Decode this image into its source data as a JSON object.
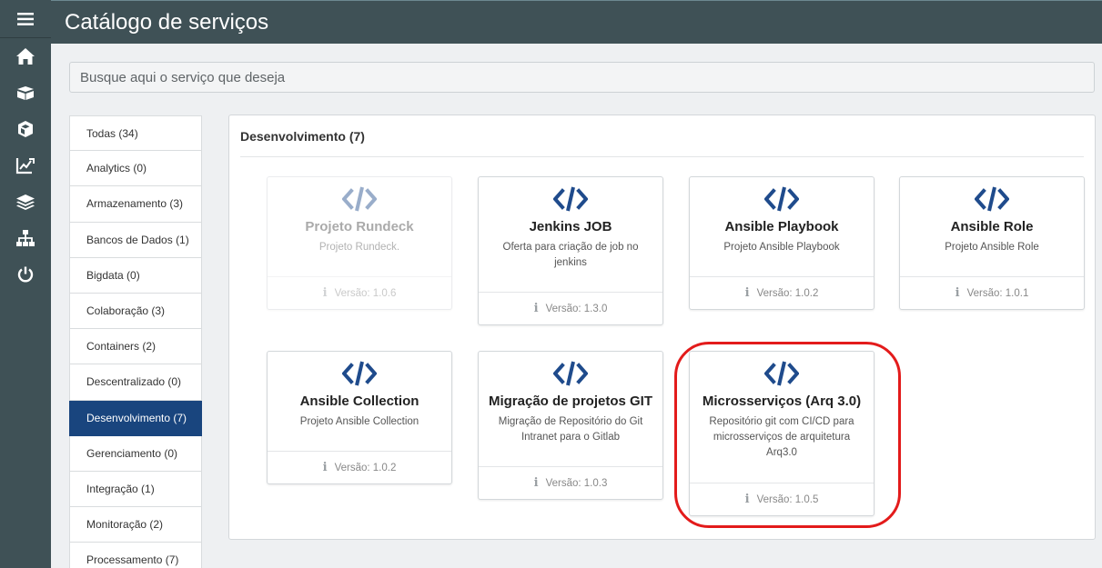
{
  "app": {
    "title": "Catálogo de serviços"
  },
  "nav": {
    "icons": [
      "menu-icon",
      "home-icon",
      "box-open-icon",
      "cube-icon",
      "edit-chart-icon",
      "layers-icon",
      "sitemap-icon",
      "power-icon"
    ]
  },
  "search": {
    "placeholder": "Busque aqui o serviço que deseja",
    "value": ""
  },
  "categories": [
    {
      "label": "Todas (34)",
      "active": false
    },
    {
      "label": "Analytics (0)",
      "active": false
    },
    {
      "label": "Armazenamento (3)",
      "active": false
    },
    {
      "label": "Bancos de Dados (1)",
      "active": false
    },
    {
      "label": "Bigdata (0)",
      "active": false
    },
    {
      "label": "Colaboração (3)",
      "active": false
    },
    {
      "label": "Containers (2)",
      "active": false
    },
    {
      "label": "Descentralizado (0)",
      "active": false
    },
    {
      "label": "Desenvolvimento (7)",
      "active": true
    },
    {
      "label": "Gerenciamento (0)",
      "active": false
    },
    {
      "label": "Integração (1)",
      "active": false
    },
    {
      "label": "Monitoração (2)",
      "active": false
    },
    {
      "label": "Processamento (7)",
      "active": false
    }
  ],
  "section": {
    "title": "Desenvolvimento (7)"
  },
  "cards": [
    {
      "title": "Projeto Rundeck",
      "description": "Projeto Rundeck.",
      "version": "Versão: 1.0.6",
      "disabled": true
    },
    {
      "title": "Jenkins JOB",
      "description": "Oferta para criação de job no jenkins",
      "version": "Versão: 1.3.0",
      "disabled": false
    },
    {
      "title": "Ansible Playbook",
      "description": "Projeto Ansible Playbook",
      "version": "Versão: 1.0.2",
      "disabled": false
    },
    {
      "title": "Ansible Role",
      "description": "Projeto Ansible Role",
      "version": "Versão: 1.0.1",
      "disabled": false
    },
    {
      "title": "Ansible Collection",
      "description": "Projeto Ansible Collection",
      "version": "Versão: 1.0.2",
      "disabled": false
    },
    {
      "title": "Migração de projetos GIT",
      "description": "Migração de Repositório do Git Intranet para o Gitlab",
      "version": "Versão: 1.0.3",
      "disabled": false
    },
    {
      "title": "Microsserviços (Arq 3.0)",
      "description": "Repositório git com CI/CD para microsserviços de arquitetura Arq3.0",
      "version": "Versão: 1.0.5",
      "disabled": false
    }
  ],
  "colors": {
    "sidebar": "#3f5156",
    "active": "#19457e",
    "code_icon": "#1f4b8c",
    "highlight": "#e31b1b"
  }
}
